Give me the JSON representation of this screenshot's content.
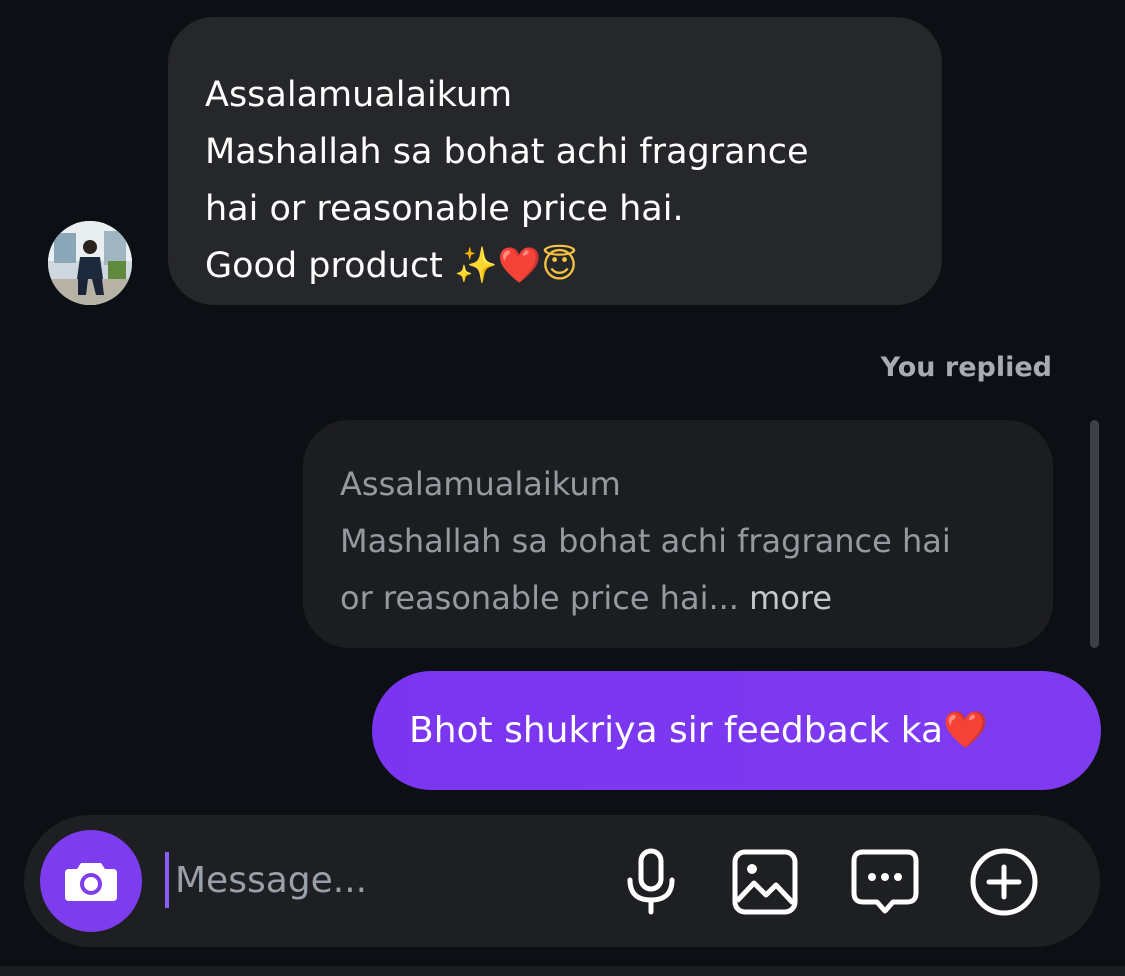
{
  "incoming": {
    "lines": [
      "Assalamualaikum",
      "Mashallah sa bohat achi fragrance",
      "hai or reasonable price hai.",
      "Good product"
    ],
    "emojis": [
      "✨",
      "❤️",
      "😇"
    ]
  },
  "reply_label": "You replied",
  "quoted": {
    "lines": [
      "Assalamualaikum",
      "Mashallah sa bohat achi fragrance hai",
      "or reasonable price hai..."
    ],
    "more_label": "more"
  },
  "outgoing": {
    "text": "Bhot shukriya sir feedback ka❤️"
  },
  "composer": {
    "placeholder": "Message...",
    "icons": [
      "camera-icon",
      "microphone-icon",
      "gallery-icon",
      "sticker-icon",
      "plus-icon"
    ]
  },
  "colors": {
    "background": "#0c0f14",
    "incoming_bubble": "#26272b",
    "quoted_bubble": "#1c1d21",
    "outgoing_bubble": "#7c3aed",
    "accent": "#7d3ced"
  }
}
